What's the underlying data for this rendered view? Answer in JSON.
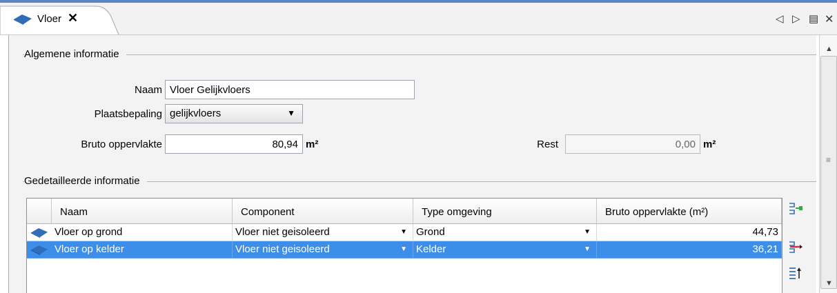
{
  "tab": {
    "label": "Vloer",
    "close": "✕"
  },
  "toolbar": {
    "prev": "◁",
    "next": "▷",
    "menu": "▤",
    "close": "✕"
  },
  "general": {
    "title": "Algemene informatie",
    "name_label": "Naam",
    "name_value": "Vloer Gelijkvloers",
    "location_label": "Plaatsbepaling",
    "location_value": "gelijkvloers",
    "gross_area_label": "Bruto oppervlakte",
    "gross_area_value": "80,94",
    "unit": "m²",
    "rest_label": "Rest",
    "rest_value": "0,00",
    "rest_unit": "m²"
  },
  "detail": {
    "title": "Gedetailleerde informatie",
    "columns": [
      "Naam",
      "Component",
      "Type omgeving",
      "Bruto oppervlakte (m²)"
    ],
    "rows": [
      {
        "name": "Vloer op grond",
        "component": "Vloer niet geisoleerd",
        "environment": "Grond",
        "area": "44,73",
        "selected": false
      },
      {
        "name": "Vloer op kelder",
        "component": "Vloer niet geisoleerd",
        "environment": "Kelder",
        "area": "36,21",
        "selected": true
      }
    ]
  },
  "colors": {
    "accent": "#5b86c2",
    "selection": "#3d8ee9",
    "icon_blue": "#2f6db8"
  },
  "icons": [
    "floor-icon",
    "add-row-icon",
    "remove-row-icon",
    "move-up-icon"
  ]
}
